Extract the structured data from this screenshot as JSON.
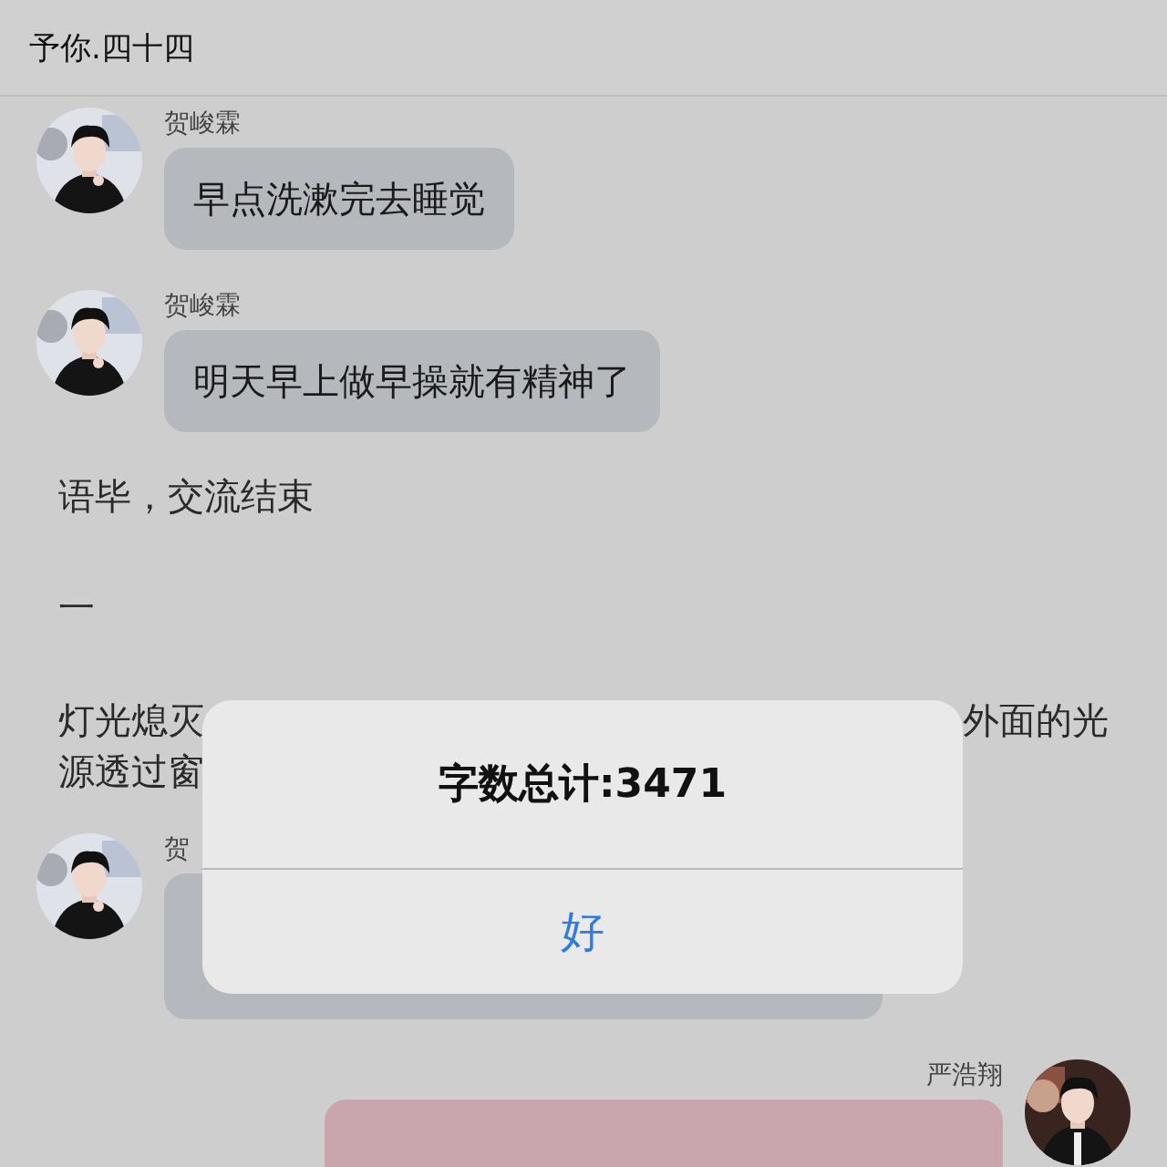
{
  "header": {
    "title": "予你.四十四"
  },
  "items": [
    {
      "kind": "incoming",
      "sender": "贺峻霖",
      "text": "早点洗漱完去睡觉"
    },
    {
      "kind": "incoming",
      "sender": "贺峻霖",
      "text": "明天早上做早操就有精神了"
    },
    {
      "kind": "narration",
      "text": "语毕，交流结束"
    },
    {
      "kind": "narration",
      "text": "一"
    },
    {
      "kind": "fragments",
      "lines": [
        [
          "灯光熄灭",
          "外面的光"
        ],
        [
          "源透过窗"
        ]
      ]
    },
    {
      "kind": "incoming",
      "sender": "贺"
    },
    {
      "kind": "outgoing",
      "sender": "严浩翔"
    }
  ],
  "dialog": {
    "message": "字数总计:3471",
    "button": "好"
  }
}
